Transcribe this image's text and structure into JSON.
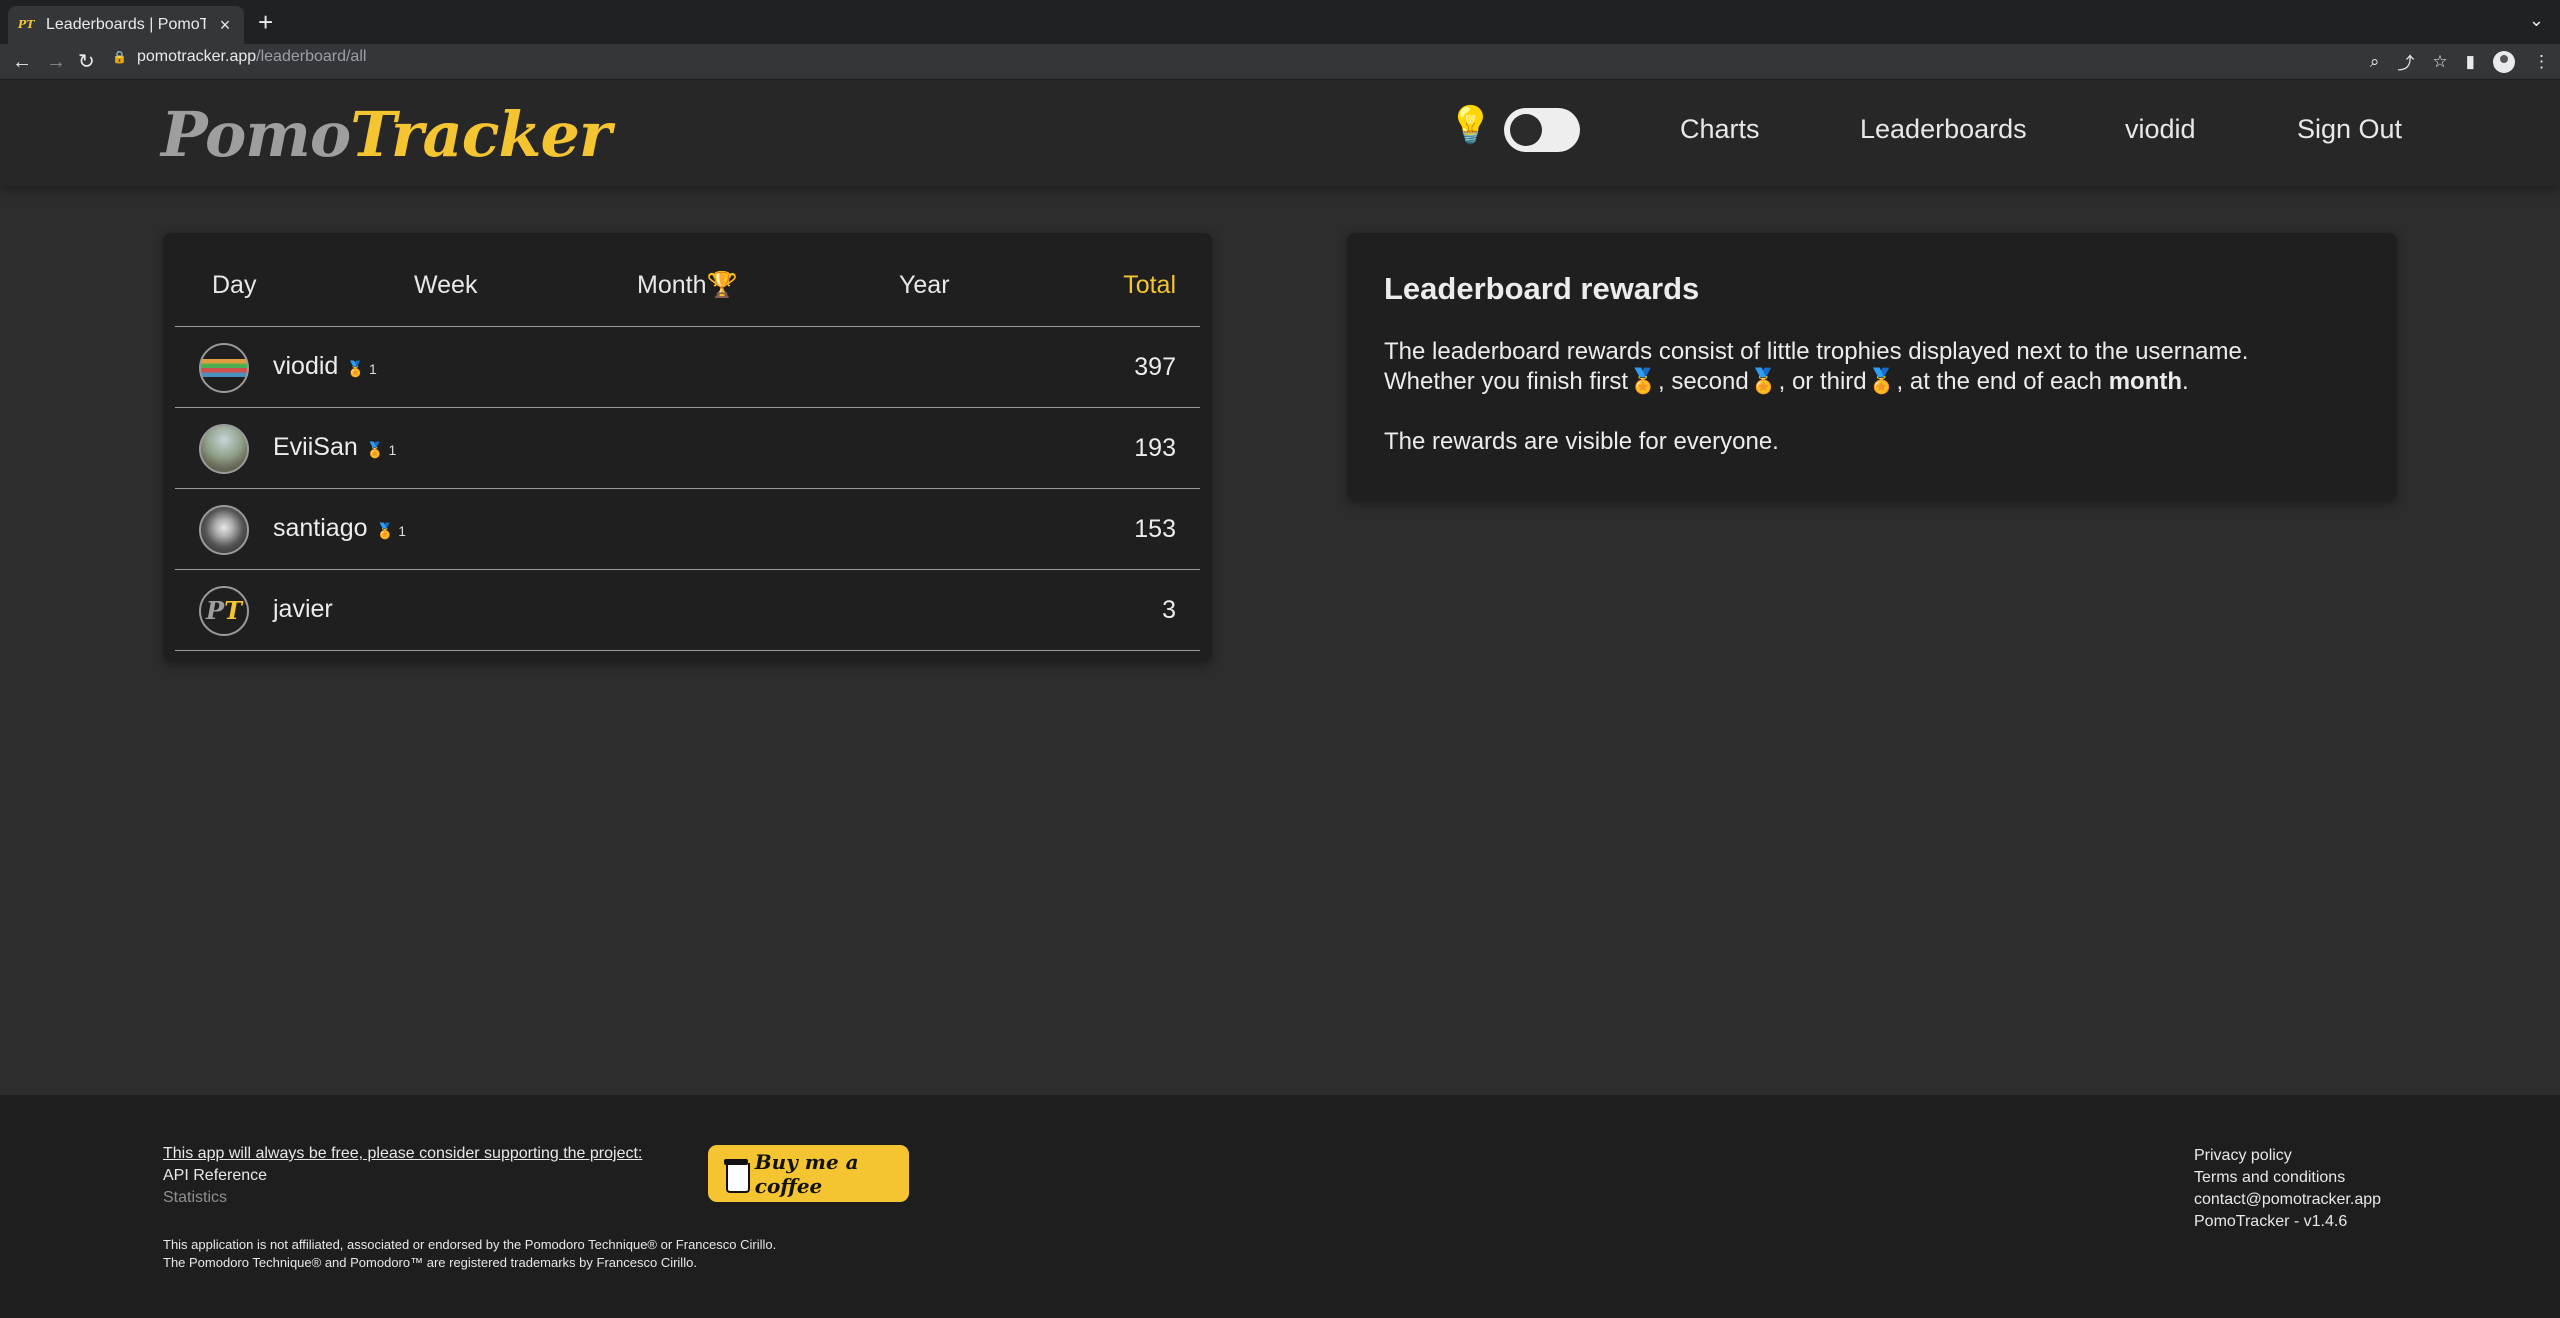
{
  "browser": {
    "tab_title": "Leaderboards | PomoTrac",
    "favicon_text": "PT",
    "url_host": "pomotracker.app",
    "url_path": "/leaderboard/all"
  },
  "header": {
    "logo_part1": "Pomo",
    "logo_part2": "Tracker",
    "nav": {
      "charts": "Charts",
      "leaderboards": "Leaderboards",
      "user": "viodid",
      "sign_out": "Sign Out"
    }
  },
  "leaderboard": {
    "tabs": {
      "day": "Day",
      "week": "Week",
      "month": "Month",
      "year": "Year",
      "total": "Total"
    },
    "active_tab": "Total",
    "rows": [
      {
        "name": "viodid",
        "medal": "gold",
        "medal_count": "1",
        "score": "397"
      },
      {
        "name": "EviiSan",
        "medal": "silver",
        "medal_count": "1",
        "score": "193"
      },
      {
        "name": "santiago",
        "medal": "bronze",
        "medal_count": "1",
        "score": "153"
      },
      {
        "name": "javier",
        "score": "3"
      }
    ]
  },
  "rewards": {
    "title": "Leaderboard rewards",
    "p1_a": "The leaderboard rewards consist of little trophies displayed next to the username.",
    "p1_b": "Whether you finish first",
    "p1_c": ", second",
    "p1_d": ", or third",
    "p1_e": ", at the end of each",
    "p1_bold": "month",
    "p1_end": ".",
    "p2": "The rewards are visible for everyone."
  },
  "footer": {
    "support": "This app will always be free, please consider supporting the project:",
    "api": "API Reference",
    "stats": "Statistics",
    "coffee": "Buy me a coffee",
    "disclaimer1": "This application is not affiliated, associated or endorsed by the Pomodoro Technique® or Francesco Cirillo.",
    "disclaimer2": "The Pomodoro Technique® and Pomodoro™ are registered trademarks by Francesco Cirillo.",
    "privacy": "Privacy policy",
    "terms": "Terms and conditions",
    "contact": "contact@pomotracker.app",
    "version": "PomoTracker - v1.4.6"
  }
}
